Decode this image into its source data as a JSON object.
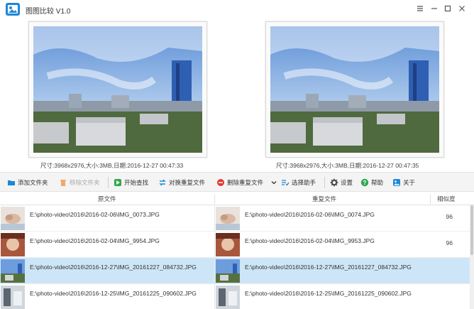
{
  "window": {
    "title": "图图比较 V1.0"
  },
  "preview": {
    "left_caption": "尺寸:3968x2976,大小:3MB,日期:2016-12-27 00:47:33",
    "right_caption": "尺寸:3968x2976,大小:3MB,日期:2016-12-27 00:47:35"
  },
  "toolbar": {
    "add_folder": "添加文件夹",
    "remove_folder": "移除文件夹",
    "start_search": "开始查找",
    "swap_duplicates": "对换重复文件",
    "delete_duplicates": "删除重复文件",
    "select_helper": "选择助手",
    "settings": "设置",
    "help": "帮助",
    "about": "关于"
  },
  "table": {
    "columns": [
      "原文件",
      "重复文件",
      "相似度"
    ],
    "rows": [
      {
        "source": "E:\\photo-video\\2016\\2016-02-06\\IMG_0073.JPG",
        "duplicate": "E:\\photo-video\\2016\\2016-02-06\\IMG_0074.JPG",
        "similarity": "96"
      },
      {
        "source": "E:\\photo-video\\2016\\2016-02-04\\IMG_9954.JPG",
        "duplicate": "E:\\photo-video\\2016\\2016-02-04\\IMG_9953.JPG",
        "similarity": "96"
      },
      {
        "source": "E:\\photo-video\\2016\\2016-12-27\\IMG_20161227_084732.JPG",
        "duplicate": "E:\\photo-video\\2016\\2016-12-27\\IMG_20161227_084732.JPG",
        "similarity": ""
      },
      {
        "source": "E:\\photo-video\\2016\\2016-12-25\\IMG_20161225_090602.JPG",
        "duplicate": "E:\\photo-video\\2016\\2016-12-25\\IMG_20161225_090602.JPG",
        "similarity": ""
      }
    ]
  },
  "colors": {
    "accent": "#1e88d6",
    "selected_row": "#cde6f7",
    "delete_red": "#e53935",
    "start_green": "#2fa84f"
  }
}
